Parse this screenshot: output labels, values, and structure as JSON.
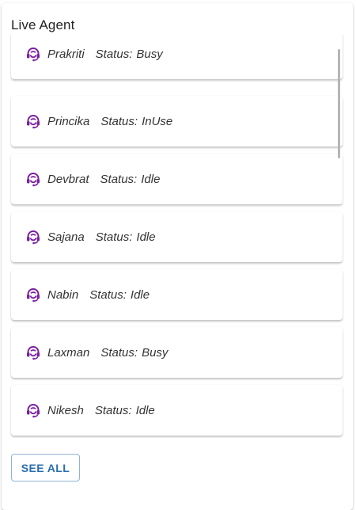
{
  "panel": {
    "title": "Live Agent",
    "see_all_label": "SEE ALL"
  },
  "agents": [
    {
      "name": "Prakriti",
      "status_label": "Status:",
      "status": "Busy",
      "icon": "headset-agent-icon"
    },
    {
      "name": "Princika",
      "status_label": "Status:",
      "status": "InUse",
      "icon": "headset-agent-icon"
    },
    {
      "name": "Devbrat",
      "status_label": "Status:",
      "status": "Idle",
      "icon": "headset-agent-icon"
    },
    {
      "name": "Sajana",
      "status_label": "Status:",
      "status": "Idle",
      "icon": "headset-agent-icon"
    },
    {
      "name": "Nabin",
      "status_label": "Status:",
      "status": "Idle",
      "icon": "headset-agent-icon"
    },
    {
      "name": "Laxman",
      "status_label": "Status:",
      "status": "Busy",
      "icon": "headset-agent-icon"
    },
    {
      "name": "Nikesh",
      "status_label": "Status:",
      "status": "Idle",
      "icon": "headset-agent-icon"
    }
  ],
  "colors": {
    "icon": "#7b1fa2",
    "button_text": "#2a6db0",
    "button_border": "#8fb4d8"
  }
}
